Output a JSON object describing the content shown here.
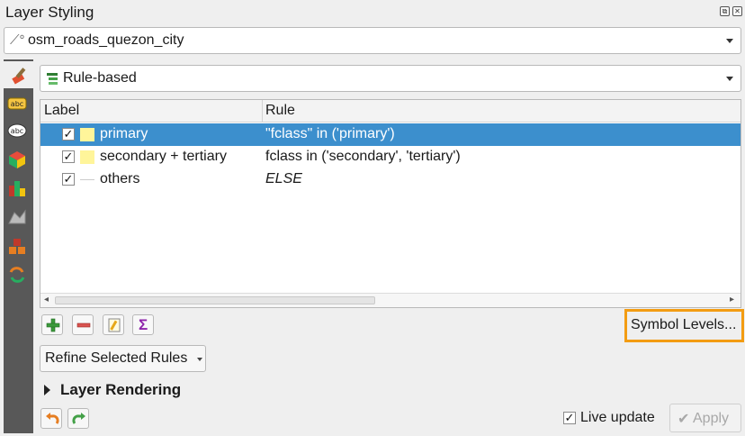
{
  "panel": {
    "title": "Layer Styling",
    "layer": {
      "name": "osm_roads_quezon_city",
      "icon": "line-layer-icon"
    },
    "renderer": {
      "label": "Rule-based",
      "icon": "rule-based-renderer-icon"
    },
    "sidebar_icons": [
      "symbology-brush-icon",
      "labels-abc-icon",
      "masks-abc-icon",
      "3d-view-icon",
      "diagrams-icon",
      "elevation-icon",
      "layer-rendering-icon",
      "history-icon"
    ]
  },
  "tree": {
    "columns": {
      "label": "Label",
      "rule": "Rule"
    },
    "rows": [
      {
        "checked": true,
        "swatch": "#fff59a",
        "label": "primary",
        "rule": "\"fclass\" in ('primary')",
        "italic": false,
        "selected": true
      },
      {
        "checked": true,
        "swatch": "#fff59a",
        "label": "secondary + tertiary",
        "rule": "fclass in ('secondary', 'tertiary')",
        "italic": false,
        "selected": false
      },
      {
        "checked": true,
        "swatch": "none",
        "label": "others",
        "rule": "ELSE",
        "italic": true,
        "selected": false
      }
    ]
  },
  "toolbar": {
    "symbol_levels": "Symbol Levels...",
    "refine": "Refine Selected Rules",
    "highlight_color": "#f39c12"
  },
  "layer_rendering": "Layer Rendering",
  "footer": {
    "live_update": "Live update",
    "live_update_checked": true,
    "apply": "Apply"
  },
  "colors": {
    "selection": "#3c8fcd",
    "sidebar": "#585858"
  }
}
